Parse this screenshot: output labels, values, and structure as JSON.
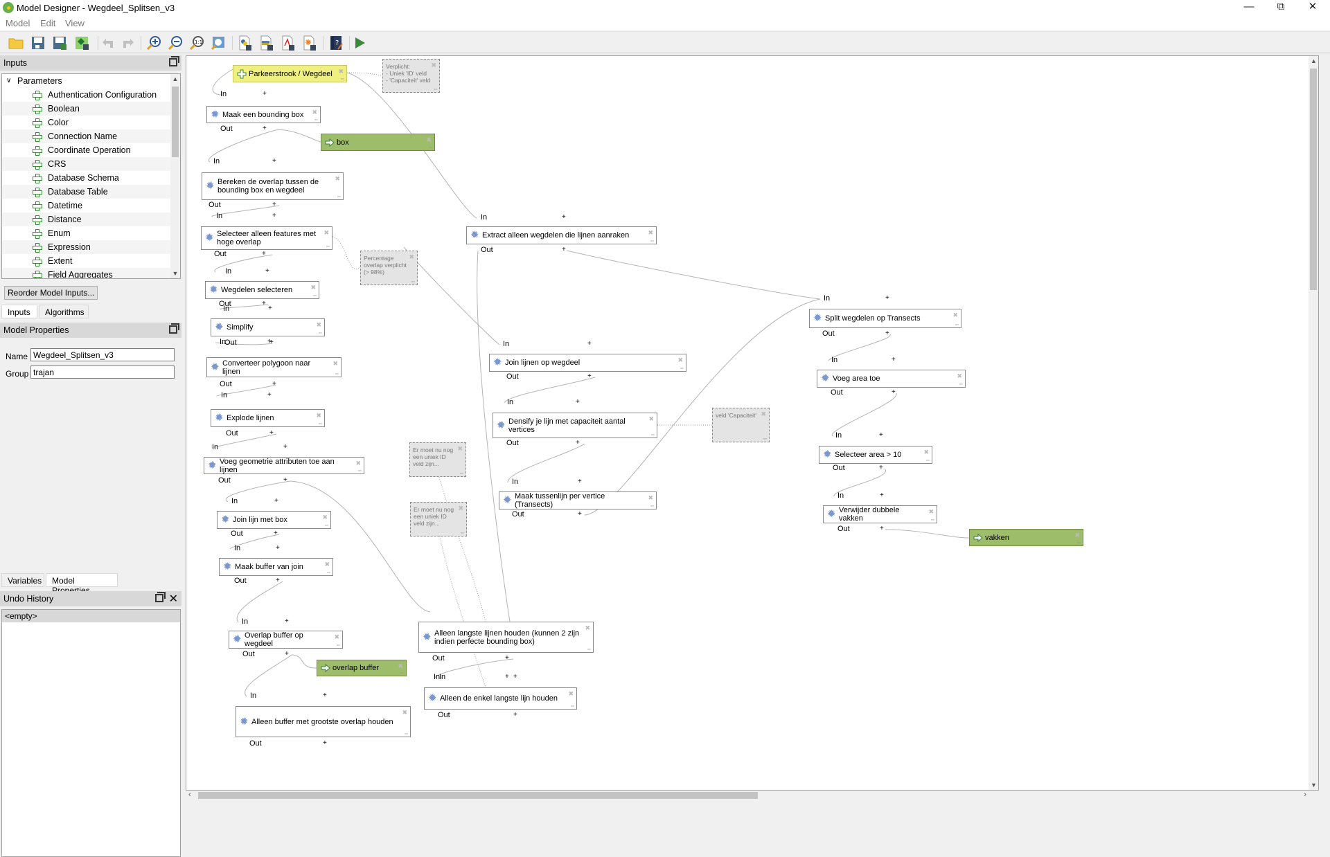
{
  "window": {
    "title": "Model Designer - Wegdeel_Splitsen_v3",
    "controls": [
      "minimize",
      "restore",
      "close"
    ]
  },
  "menu": [
    "Model",
    "Edit",
    "View"
  ],
  "toolbar": [
    {
      "icon": "open-folder-icon",
      "label": "Open model"
    },
    {
      "icon": "save-icon",
      "label": "Save model"
    },
    {
      "icon": "save-as-icon",
      "label": "Save model as"
    },
    {
      "icon": "save-in-project-icon",
      "label": "Save into project"
    },
    {
      "icon": "undo-icon",
      "label": "Undo"
    },
    {
      "icon": "redo-icon",
      "label": "Redo"
    },
    {
      "icon": "zoom-in-icon",
      "label": "Zoom in"
    },
    {
      "icon": "zoom-out-icon",
      "label": "Zoom out"
    },
    {
      "icon": "zoom-actual-icon",
      "label": "Zoom to 100%"
    },
    {
      "icon": "zoom-full-icon",
      "label": "Zoom full"
    },
    {
      "icon": "export-python-icon",
      "label": "Export as Python"
    },
    {
      "icon": "export-image-icon",
      "label": "Export as image"
    },
    {
      "icon": "export-pdf-icon",
      "label": "Export as PDF"
    },
    {
      "icon": "export-svg-icon",
      "label": "Export as SVG"
    },
    {
      "icon": "edit-help-icon",
      "label": "Edit model help"
    },
    {
      "icon": "run-icon",
      "label": "Run model"
    }
  ],
  "inputs_panel": {
    "title": "Inputs",
    "group": "Parameters",
    "items": [
      "Authentication Configuration",
      "Boolean",
      "Color",
      "Connection Name",
      "Coordinate Operation",
      "CRS",
      "Database Schema",
      "Database Table",
      "Datetime",
      "Distance",
      "Enum",
      "Expression",
      "Extent",
      "Field Aggregates"
    ],
    "reorder_button": "Reorder Model Inputs...",
    "tabs": [
      "Inputs",
      "Algorithms"
    ],
    "active_tab": "Inputs"
  },
  "model_properties": {
    "title": "Model Properties",
    "name_label": "Name",
    "name_value": "Wegdeel_Splitsen_v3",
    "group_label": "Group",
    "group_value": "trajan",
    "tabs": [
      "Variables",
      "Model Properties"
    ],
    "active_tab": "Model Properties"
  },
  "undo_history": {
    "title": "Undo History",
    "items": [
      "<empty>"
    ]
  },
  "ports": {
    "in": "In",
    "out": "Out",
    "plus": "+"
  },
  "canvas": {
    "inputs": [
      {
        "id": "n_input",
        "label": "Parkeerstrook / Wegdeel"
      }
    ],
    "algorithms": [
      {
        "id": "n1",
        "label": "Maak een bounding box"
      },
      {
        "id": "n2",
        "label": "Bereken de overlap tussen de bounding box en wegdeel"
      },
      {
        "id": "n3",
        "label": "Selecteer alleen features met hoge overlap"
      },
      {
        "id": "n4",
        "label": "Wegdelen selecteren"
      },
      {
        "id": "n5",
        "label": "Simplify"
      },
      {
        "id": "n6",
        "label": "Converteer polygoon naar lijnen"
      },
      {
        "id": "n7",
        "label": "Explode lijnen"
      },
      {
        "id": "n8",
        "label": "Voeg geometrie attributen toe aan lijnen"
      },
      {
        "id": "n9",
        "label": "Join lijn met box"
      },
      {
        "id": "n10",
        "label": "Maak buffer van join"
      },
      {
        "id": "n11",
        "label": "Overlap buffer op wegdeel"
      },
      {
        "id": "n12",
        "label": "Alleen buffer met grootste overlap houden"
      },
      {
        "id": "n13",
        "label": "Extract alleen wegdelen die lijnen aanraken"
      },
      {
        "id": "n14",
        "label": "Join lijnen op wegdeel"
      },
      {
        "id": "n15",
        "label": "Densify je lijn met capaciteit aantal vertices"
      },
      {
        "id": "n16",
        "label": "Maak tussenlijn per vertice (Transects)"
      },
      {
        "id": "n17",
        "label": "Alleen langste lijnen houden (kunnen 2 zijn indien perfecte bounding box)"
      },
      {
        "id": "n18",
        "label": "Alleen de enkel langste lijn houden"
      },
      {
        "id": "n19",
        "label": "Split  wegdelen op Transects"
      },
      {
        "id": "n20",
        "label": "Voeg area toe"
      },
      {
        "id": "n21",
        "label": "Selecteer area > 10"
      },
      {
        "id": "n22",
        "label": "Verwijder dubbele vakken"
      }
    ],
    "outputs": [
      {
        "id": "o_box",
        "label": "box"
      },
      {
        "id": "o_overlap",
        "label": "overlap buffer"
      },
      {
        "id": "o_vakken",
        "label": "vakken"
      }
    ],
    "notes": [
      {
        "id": "c1",
        "text": "Verplicht:\n- Uniek 'ID' veld\n- 'Capaciteit' veld"
      },
      {
        "id": "c2",
        "text": "Percentage overlap verplicht (> 98%)"
      },
      {
        "id": "c3",
        "text": "veld 'Capaciteit'"
      },
      {
        "id": "c4",
        "text": "Er moet nu nog een uniek ID veld zijn..."
      },
      {
        "id": "c5",
        "text": "Er moet nu nog een uniek ID veld zijn..."
      }
    ]
  },
  "colors": {
    "input_node": "#f0f080",
    "output_node": "#9ebd6a",
    "note_node": "#e4e4e4",
    "gear_icon": "#7b97cf"
  }
}
